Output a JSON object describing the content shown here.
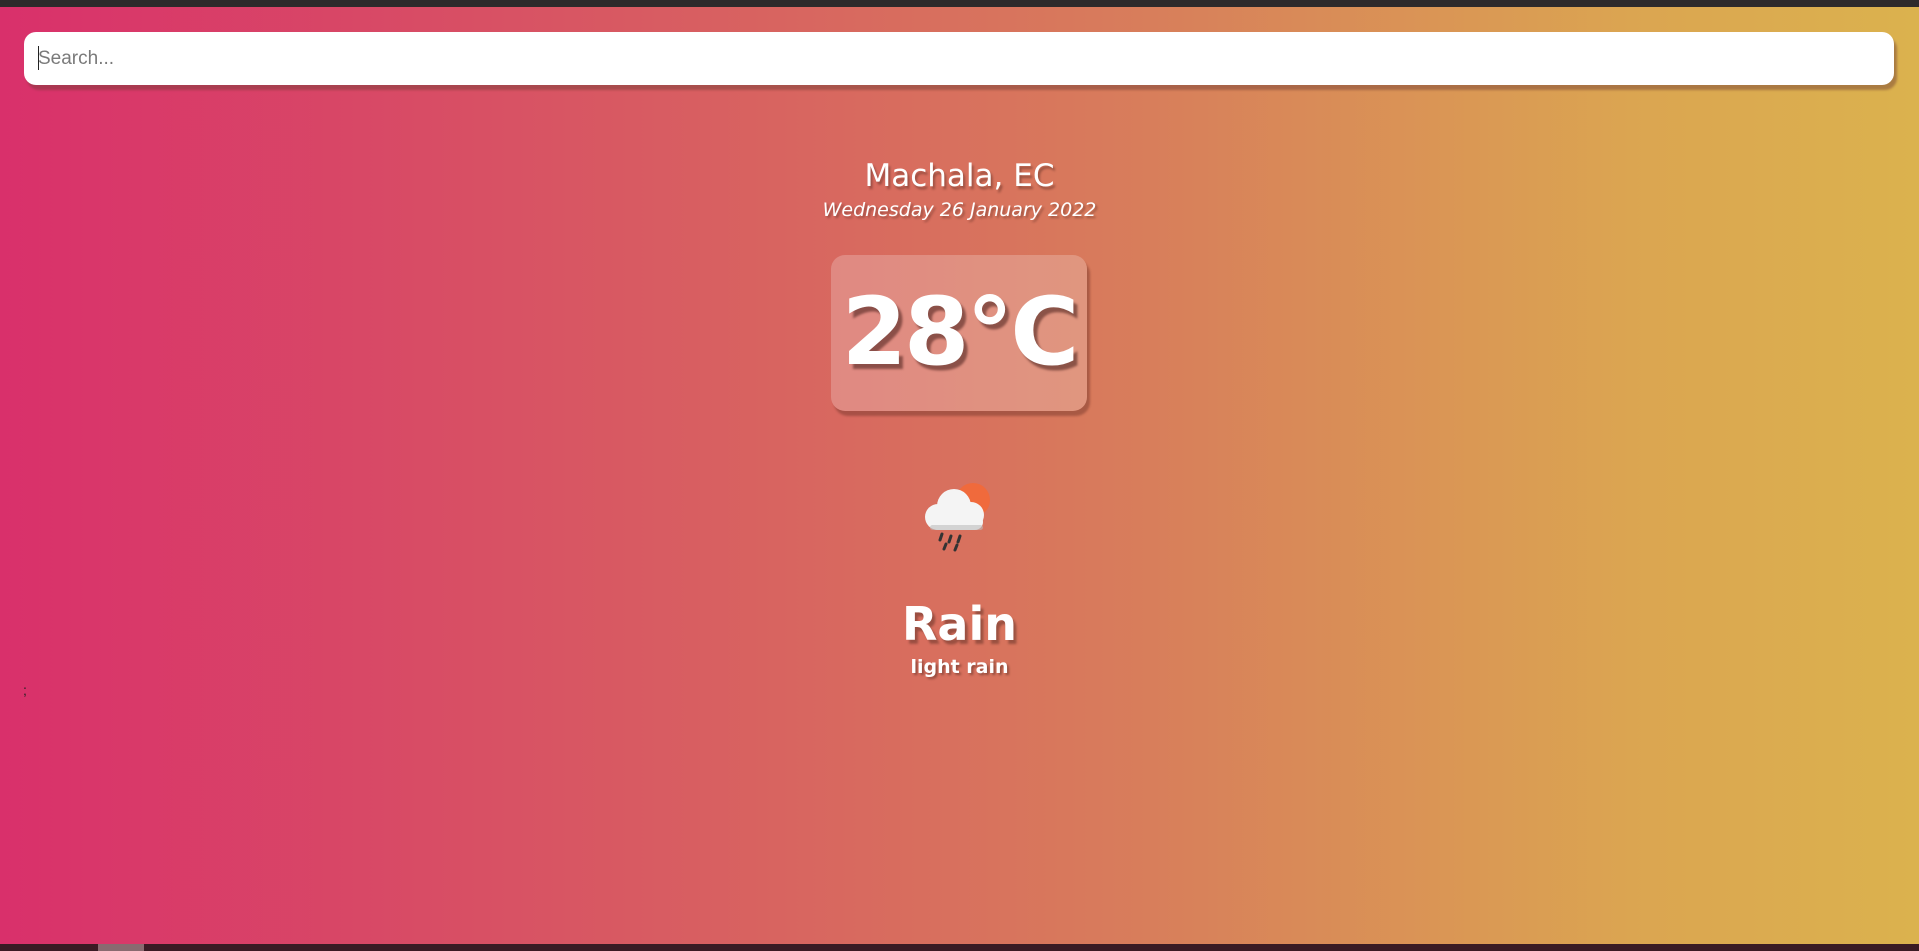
{
  "search": {
    "placeholder": "Search...",
    "value": ""
  },
  "location": {
    "city_country": "Machala, EC",
    "date": "Wednesday 26 January 2022"
  },
  "weather": {
    "temperature": "28°C",
    "condition": "Rain",
    "description": "light rain",
    "icon": "rain-cloud-sun-icon"
  },
  "stray_text": ";",
  "colors": {
    "gradient_start": "#d9306b",
    "gradient_end": "#dbb24e",
    "text": "#ffffff"
  }
}
